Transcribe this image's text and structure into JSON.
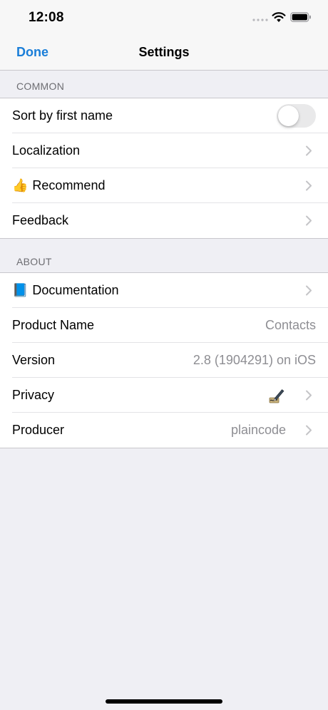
{
  "status_bar": {
    "time": "12:08",
    "icons": [
      "signal-icon",
      "wifi-icon",
      "battery-icon"
    ]
  },
  "nav": {
    "done_label": "Done",
    "title": "Settings"
  },
  "sections": {
    "common": {
      "header": "COMMON",
      "rows": {
        "sort": {
          "label": "Sort by first name",
          "toggle_on": false
        },
        "localization": {
          "label": "Localization"
        },
        "recommend": {
          "emoji": "👍",
          "label": "Recommend"
        },
        "feedback": {
          "label": "Feedback"
        }
      }
    },
    "about": {
      "header": "ABOUT",
      "rows": {
        "documentation": {
          "emoji": "📘",
          "label": "Documentation"
        },
        "product_name": {
          "label": "Product Name",
          "value": "Contacts"
        },
        "version": {
          "label": "Version",
          "value": "2.8 (1904291) on iOS"
        },
        "privacy": {
          "label": "Privacy",
          "icon": "signature-pen-icon"
        },
        "producer": {
          "label": "Producer",
          "value": "plaincode"
        }
      }
    }
  },
  "colors": {
    "accent": "#1a7ed8",
    "background": "#efeff4",
    "secondary_text": "#8e8e93",
    "section_header": "#6d6d72",
    "separator": "#c8c7cc"
  }
}
